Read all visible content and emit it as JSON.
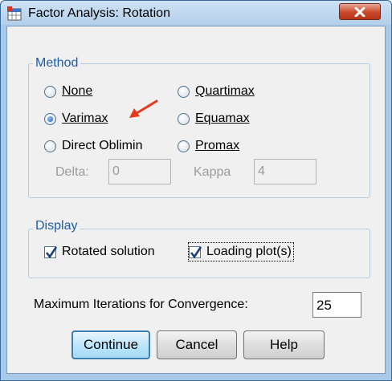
{
  "window": {
    "title": "Factor Analysis: Rotation"
  },
  "method": {
    "legend": "Method",
    "options": [
      {
        "label": "None",
        "checked": false
      },
      {
        "label": "Varimax",
        "checked": true
      },
      {
        "label": "Direct Oblimin",
        "checked": false
      },
      {
        "label": "Quartimax",
        "checked": false
      },
      {
        "label": "Equamax",
        "checked": false
      },
      {
        "label": "Promax",
        "checked": false
      }
    ],
    "delta_label": "Delta:",
    "delta_value": "0",
    "kappa_label": "Kappa",
    "kappa_value": "4"
  },
  "display": {
    "legend": "Display",
    "rotated_solution": {
      "label": "Rotated solution",
      "checked": true
    },
    "loading_plots": {
      "label": "Loading plot(s)",
      "checked": true
    }
  },
  "iterations": {
    "label": "Maximum Iterations for Convergence:",
    "value": "25"
  },
  "buttons": {
    "continue": "Continue",
    "cancel": "Cancel",
    "help": "Help"
  },
  "colors": {
    "accent": "#1d5ba8",
    "arrow": "#e8391f"
  }
}
